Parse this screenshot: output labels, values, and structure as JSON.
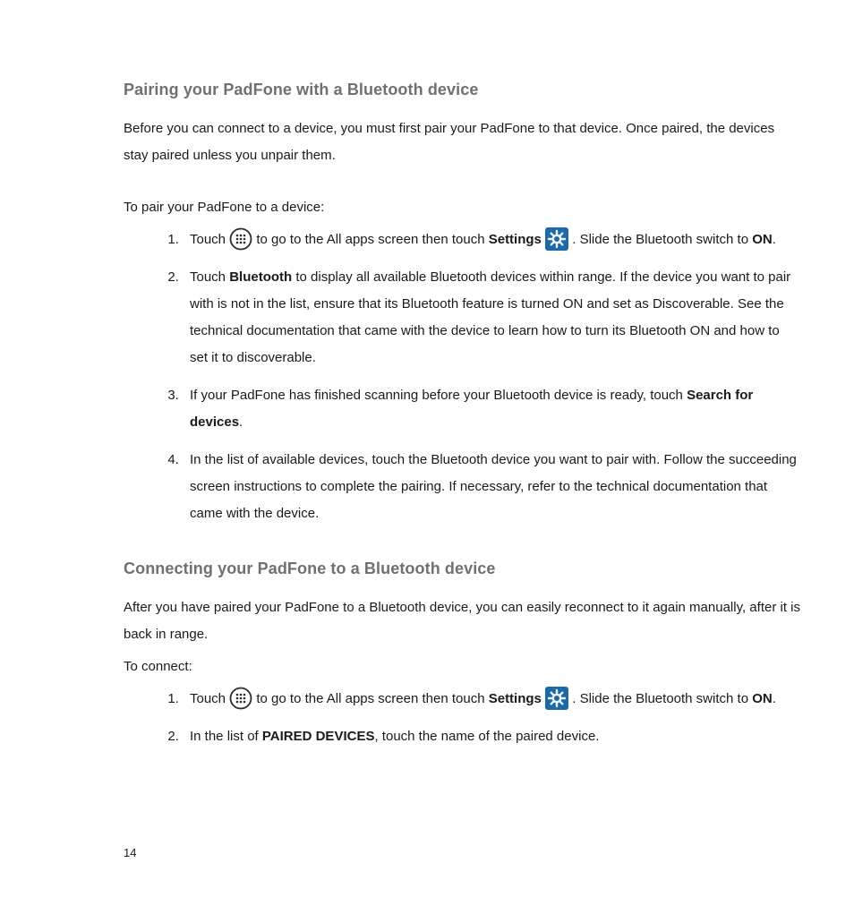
{
  "page_number": "14",
  "section1": {
    "title": "Pairing your PadFone with a Bluetooth device",
    "intro": "Before you can connect to a device, you must first pair your PadFone to that device. Once paired, the devices stay paired unless you unpair them.",
    "lead": "To pair your PadFone to a device:",
    "step1": {
      "pre_icon1": "Touch ",
      "post_icon1_pre_bold": " to go to the All apps screen then touch ",
      "bold1": "Settings",
      "post_icon2": " . Slide the Bluetooth switch to ",
      "bold2": "ON",
      "tail": "."
    },
    "step2": {
      "pre": "Touch ",
      "bold": "Bluetooth",
      "post": " to display all available Bluetooth devices within range. If the device you want to pair with is not in the list, ensure that its Bluetooth feature is turned ON and set as Discoverable. See the technical documentation that came with the device to learn how to turn its Bluetooth ON and how to set it to discoverable."
    },
    "step3": {
      "pre": "If your PadFone has finished scanning before your Bluetooth device is ready, touch ",
      "bold": "Search for devices",
      "tail": "."
    },
    "step4": "In the list of available devices, touch the Bluetooth device you want to pair with. Follow the succeeding screen instructions to complete the pairing. If necessary, refer to the technical documentation that came with the device."
  },
  "section2": {
    "title": "Connecting your PadFone to a Bluetooth device",
    "intro": "After you have paired your PadFone to a Bluetooth device, you can easily reconnect to it again manually, after it is back in range.",
    "lead": "To connect:",
    "step1": {
      "pre_icon1": "Touch ",
      "post_icon1_pre_bold": " to go to the All apps screen then touch ",
      "bold1": "Settings",
      "post_icon2": " . Slide the Bluetooth switch to ",
      "bold2": "ON",
      "tail": "."
    },
    "step2": {
      "pre": "In the list of ",
      "bold": "PAIRED DEVICES",
      "post": ", touch the name of the paired device."
    }
  },
  "icons": {
    "allapps": "all-apps",
    "settings": "settings-gear"
  }
}
